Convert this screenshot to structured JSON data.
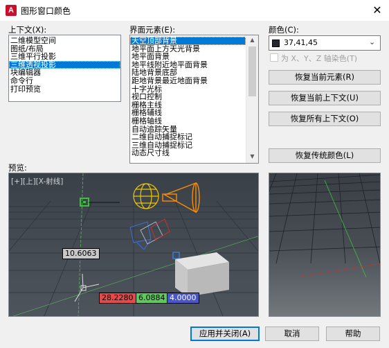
{
  "window": {
    "title": "图形窗口颜色",
    "app_icon_letter": "A"
  },
  "context": {
    "label": "上下文(X):",
    "items": [
      "二维模型空间",
      "图纸/布局",
      "三维平行投影",
      "三维透视投影",
      "块编辑器",
      "命令行",
      "打印预览"
    ],
    "selected_index": 3
  },
  "elements": {
    "label": "界面元素(E):",
    "items": [
      "天空顶部背景",
      "地平面上方天光背景",
      "地平面背景",
      "地平线附近地平面背景",
      "陆地背景底部",
      "距地背景最近地面背景",
      "十字光标",
      "视口控制",
      "栅格主线",
      "栅格辅线",
      "栅格轴线",
      "自动追踪矢量",
      "二维自动捕捉标记",
      "三维自动捕捉标记",
      "动态尺寸线"
    ],
    "selected_index": 0
  },
  "color": {
    "label": "颜色(C):",
    "value": "37,41,45",
    "swatch_hex": "#25292d",
    "tint_label": "为 X、Y、Z 轴染色(T)",
    "tint_checked": false,
    "tint_enabled": false
  },
  "buttons": {
    "restore_element": "恢复当前元素(R)",
    "restore_context": "恢复当前上下文(U)",
    "restore_all": "恢复所有上下文(O)",
    "restore_classic": "恢复传统颜色(L)",
    "apply_close": "应用并关闭(A)",
    "cancel": "取消",
    "help": "帮助"
  },
  "preview": {
    "label": "预览:",
    "viewport_label": "[+][上][X-射线]",
    "dim_1": "10.6063",
    "dim_2": "28.2280",
    "dim_3": "6.0884",
    "dim_4": "4.0000"
  }
}
